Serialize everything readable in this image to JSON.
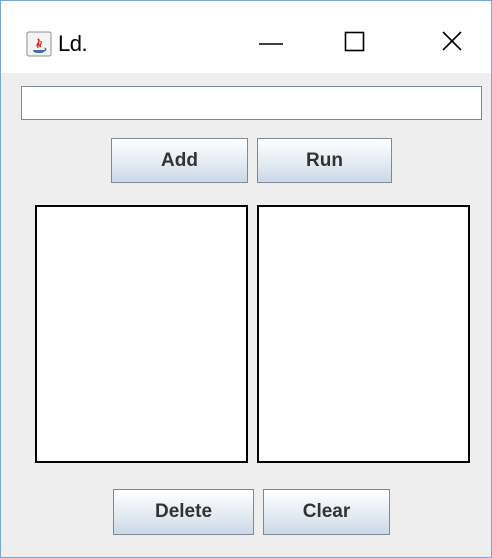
{
  "window": {
    "title": "Ld.",
    "icon": "java-icon",
    "controls": {
      "minimize_icon": "minimize-icon",
      "maximize_icon": "maximize-icon",
      "close_icon": "close-icon"
    }
  },
  "input": {
    "value": "",
    "placeholder": ""
  },
  "buttons": {
    "add_label": "Add",
    "run_label": "Run",
    "delete_label": "Delete",
    "clear_label": "Clear"
  },
  "lists": {
    "left_items": [],
    "right_items": []
  },
  "colors": {
    "window_border": "#7aa6d6",
    "content_background": "#eeeeee",
    "titlebar_background": "#ffffff",
    "button_text": "#333333"
  }
}
